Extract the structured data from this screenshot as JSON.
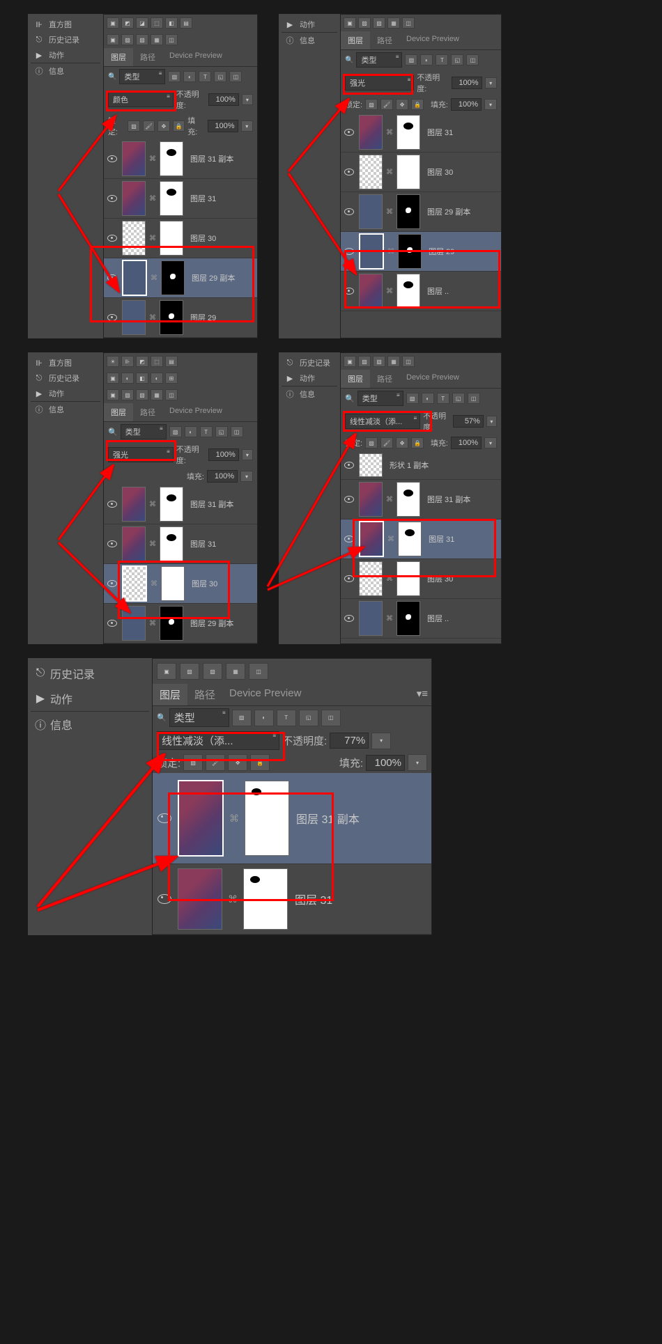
{
  "sidebar": {
    "histogram": "直方图",
    "history": "历史记录",
    "actions": "动作",
    "info": "信息"
  },
  "tabs": {
    "layers": "图层",
    "paths": "路径",
    "device_preview": "Device Preview"
  },
  "filter": {
    "kind": "类型"
  },
  "blend": {
    "color": "颜色",
    "vivid_light": "强光",
    "linear_dodge": "线性减淡（添...",
    "linear_dodge_long": "线性减淡（添..."
  },
  "labels": {
    "opacity": "不透明度:",
    "fill": "填充:",
    "lock": "锁定:"
  },
  "values": {
    "p100": "100%",
    "p57": "57%",
    "p77": "77%"
  },
  "layers": {
    "l31_copy": "图层 31 副本",
    "l31": "图层 31",
    "l30": "图层 30",
    "l29_copy": "图层 29 副本",
    "l29": "图层 29",
    "shape1_copy": "形状 1 副本"
  }
}
